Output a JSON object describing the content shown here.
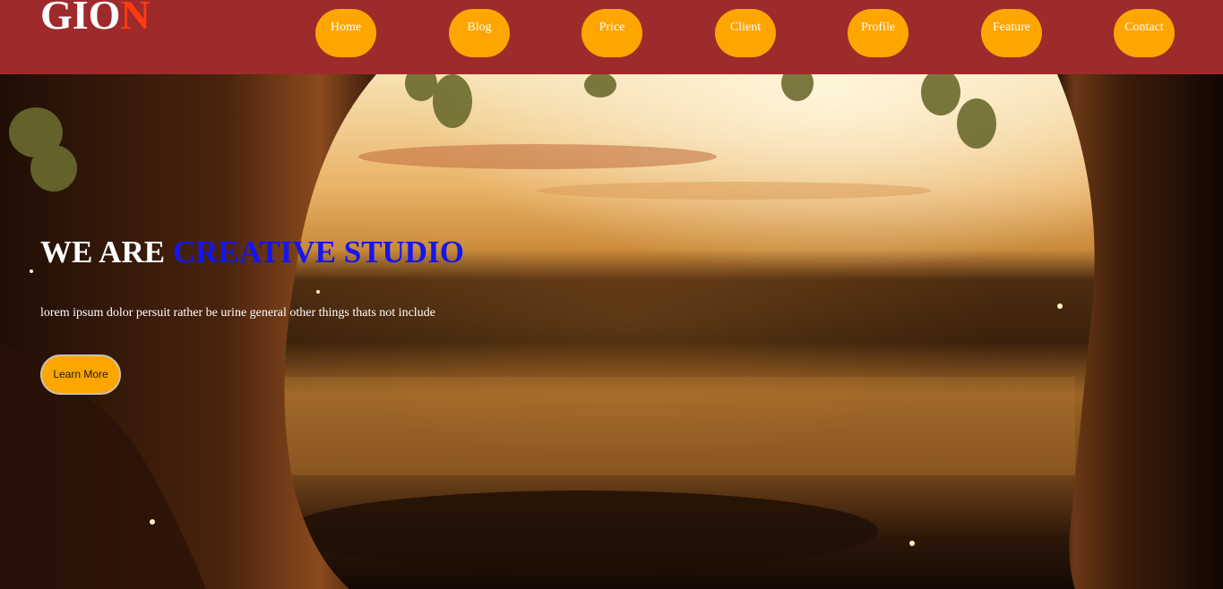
{
  "header": {
    "logo_main": "GIO",
    "logo_accent": "N",
    "nav": [
      {
        "label": "Home"
      },
      {
        "label": "Blog"
      },
      {
        "label": "Price"
      },
      {
        "label": "Client"
      },
      {
        "label": "Profile"
      },
      {
        "label": "Feature"
      },
      {
        "label": "Contact"
      }
    ]
  },
  "hero": {
    "headline_prefix": "WE ARE ",
    "headline_highlight": "CREATIVE STUDIO",
    "tagline": "lorem ipsum dolor persuit rather be urine general other things thats not include",
    "cta_label": "Learn More"
  },
  "colors": {
    "header_bg": "#9e2a2b",
    "nav_pill": "#ffa500",
    "logo_accent": "#ff3b0f",
    "headline_highlight": "#1515ee"
  }
}
